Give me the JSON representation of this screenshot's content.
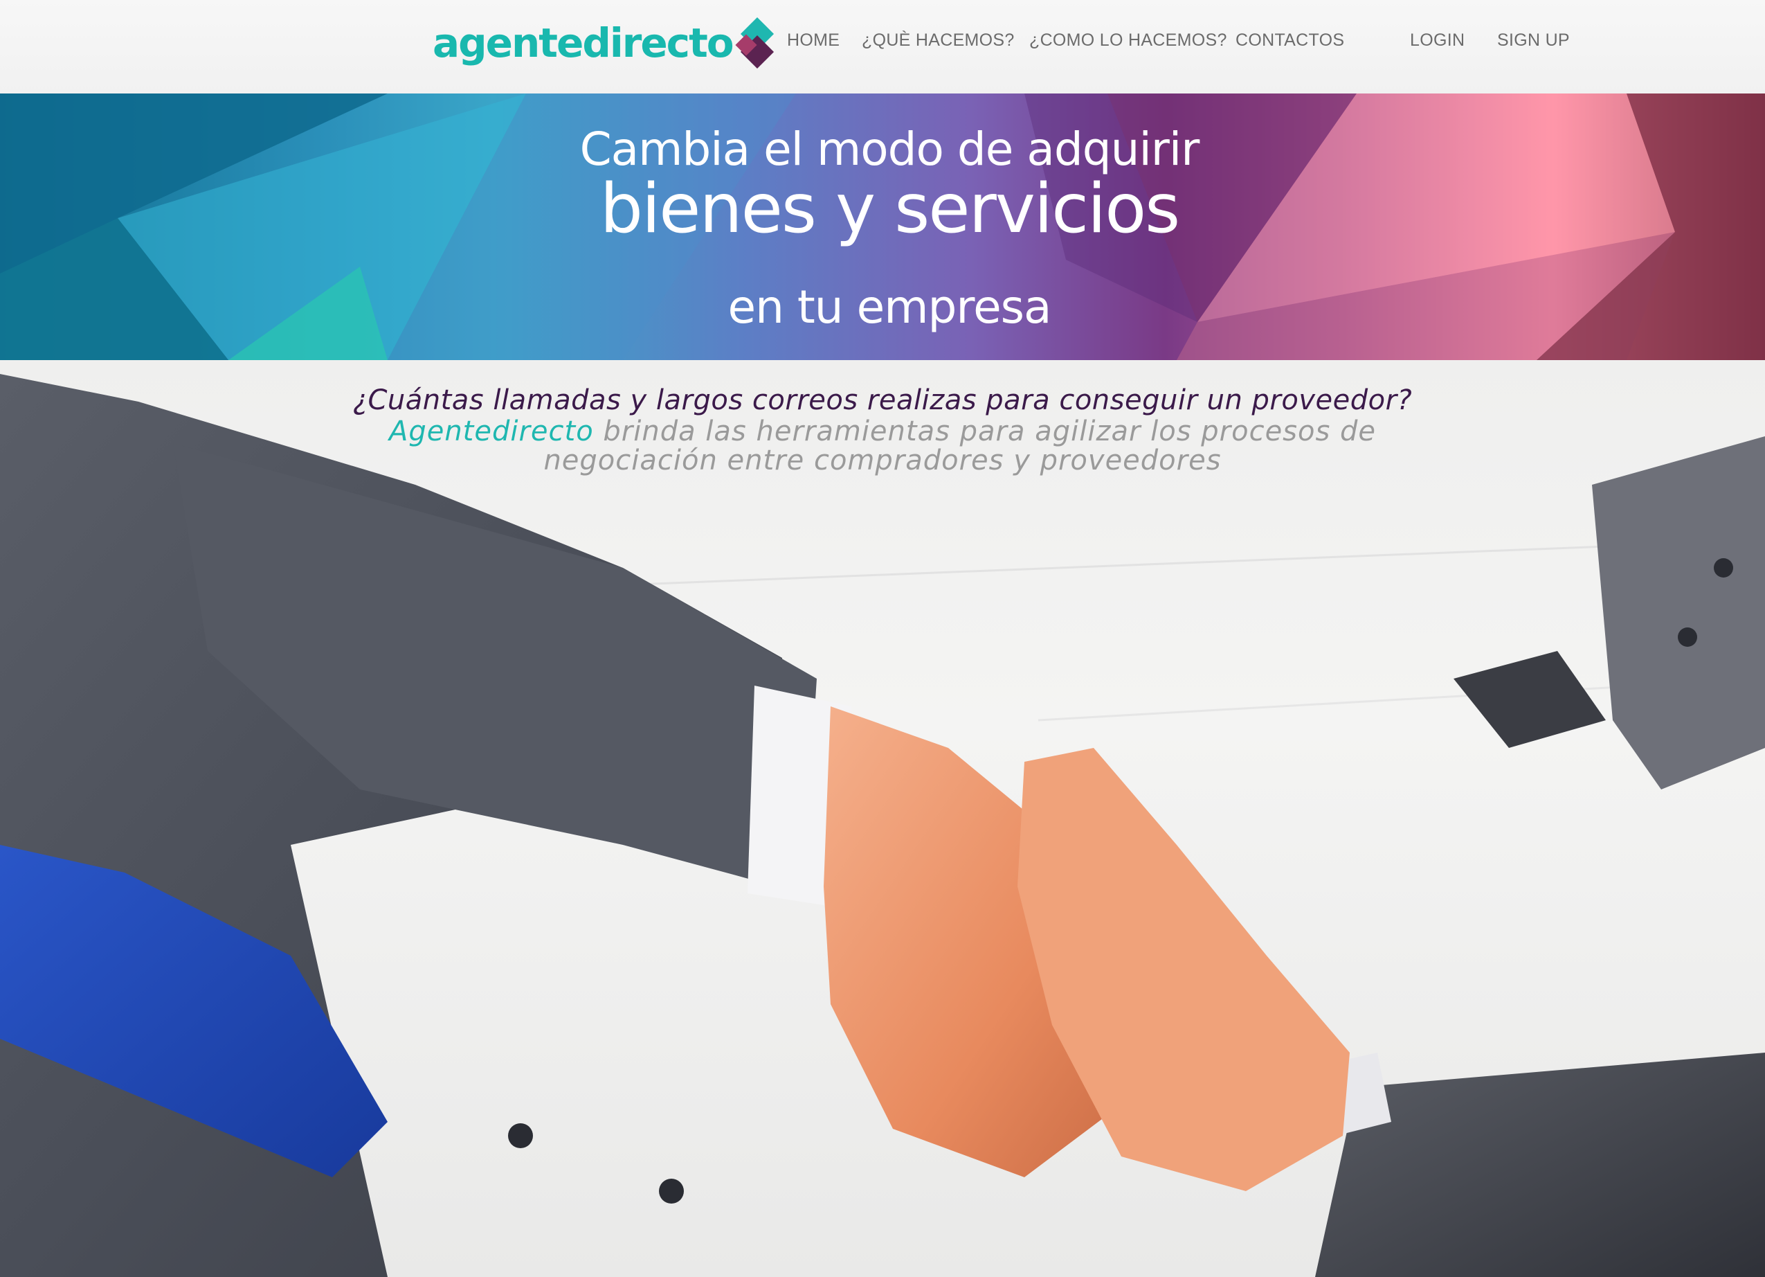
{
  "header": {
    "logo_text": "agentedirecto",
    "nav": {
      "home": "HOME",
      "que": "¿QUÈ HACEMOS?",
      "como": "¿COMO LO HACEMOS?",
      "contactos": "CONTACTOS",
      "login": "LOGIN",
      "signup": "SIGN UP"
    }
  },
  "banner": {
    "line1": "Cambia el modo de adquirir",
    "line2": "bienes y servicios",
    "line3": "en tu empresa"
  },
  "intro": {
    "question": "¿Cuántas llamadas y largos correos realizas para conseguir un proveedor?",
    "brand": "Agentedirecto",
    "description": " brinda las herramientas para agilizar los procesos de negociación entre compradores y proveedores"
  },
  "colors": {
    "brand_teal": "#1fb7b0",
    "brand_purple": "#5b2351",
    "tagline_purple": "#3b1a4a",
    "nav_gray": "#6b6b6b"
  },
  "icons": {
    "logo_mark": "diamond-logo-icon"
  },
  "image": {
    "subject": "handshake"
  }
}
